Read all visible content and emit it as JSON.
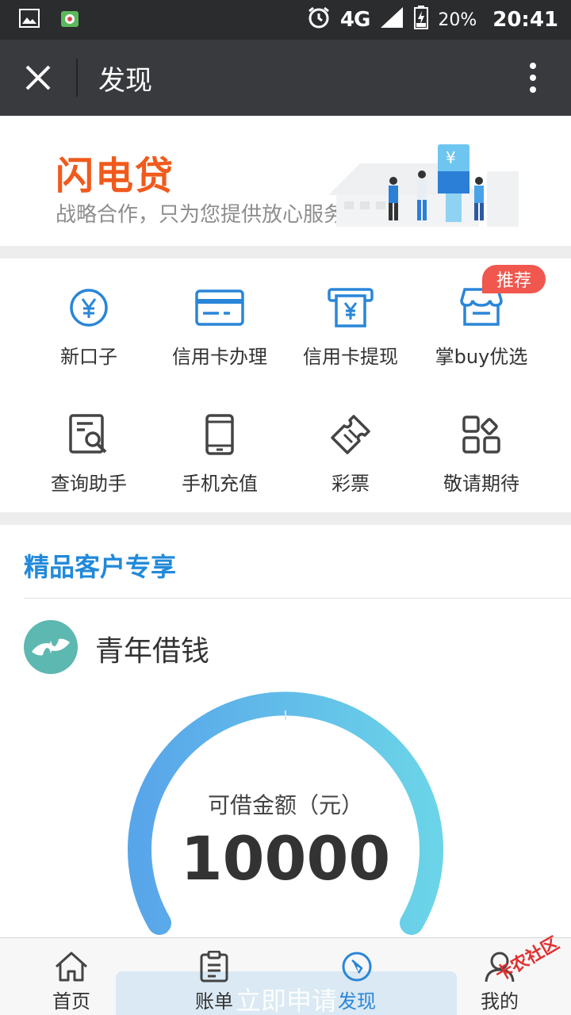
{
  "status_bar": {
    "network": "4G",
    "battery": "20%",
    "time": "20:41"
  },
  "nav": {
    "title": "发现"
  },
  "banner": {
    "brand": "闪电贷",
    "subtitle": "战略合作，只为您提供放心服务"
  },
  "services": [
    {
      "label": "新口子",
      "icon": "yen-circle-icon"
    },
    {
      "label": "信用卡办理",
      "icon": "credit-card-icon"
    },
    {
      "label": "信用卡提现",
      "icon": "atm-cash-icon"
    },
    {
      "label": "掌buy优选",
      "icon": "shop-icon",
      "badge": "推荐"
    },
    {
      "label": "查询助手",
      "icon": "search-document-icon"
    },
    {
      "label": "手机充值",
      "icon": "phone-icon"
    },
    {
      "label": "彩票",
      "icon": "ticket-icon"
    },
    {
      "label": "敬请期待",
      "icon": "more-grid-icon"
    }
  ],
  "exclusive": {
    "title": "精品客户专享",
    "product_name": "青年借钱",
    "amount_label": "可借金额（元）",
    "amount": "10000"
  },
  "tabbar": {
    "apply": "立即申请",
    "tabs": [
      {
        "label": "首页",
        "icon": "home-icon"
      },
      {
        "label": "账单",
        "icon": "bill-icon"
      },
      {
        "label": "发现",
        "icon": "compass-icon",
        "active": true
      },
      {
        "label": "我的",
        "icon": "user-icon"
      }
    ]
  },
  "watermark": "卡农社区",
  "colors": {
    "accent": "#2a86d8",
    "brand_orange": "#f05a1c",
    "badge_red": "#f0574e",
    "nav_bg": "#393a3e"
  }
}
